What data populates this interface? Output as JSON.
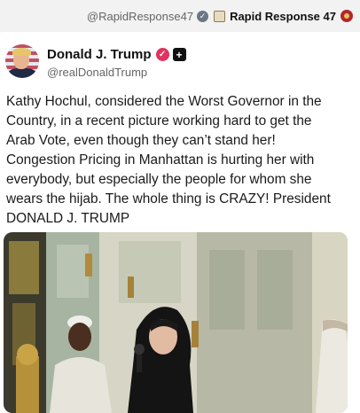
{
  "top_bar": {
    "handle": "@RapidResponse47",
    "name": "Rapid Response 47"
  },
  "post": {
    "display_name": "Donald J. Trump",
    "handle": "@realDonaldTrump",
    "lines": [
      "Kathy Hochul, considered the Worst Governor in the",
      "Country, in a recent picture working hard to get the",
      "Arab Vote, even though they can’t stand her!",
      "Congestion Pricing in Manhattan is hurting her with",
      "everybody, but especially the people for whom she",
      "wears the hijab. The whole thing is CRAZY! President",
      "DONALD J. TRUMP"
    ]
  },
  "icons": {
    "verified_gray": "verified-badge-icon",
    "seal": "presidential-seal-icon",
    "rr_badge": "rapid-response-logo-icon",
    "verified_pink": "verified-badge-icon",
    "truth_logo": "truth-social-plus-icon"
  },
  "colors": {
    "verified_pink": "#e0335e",
    "verified_gray": "#6b7785",
    "rr_badge": "#b3262c"
  }
}
